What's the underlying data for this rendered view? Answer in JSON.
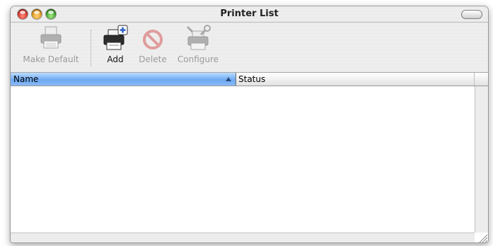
{
  "window": {
    "title": "Printer List"
  },
  "toolbar": {
    "make_default": {
      "label": "Make Default",
      "enabled": false
    },
    "add": {
      "label": "Add",
      "enabled": true
    },
    "delete": {
      "label": "Delete",
      "enabled": false
    },
    "configure": {
      "label": "Configure",
      "enabled": false
    }
  },
  "table": {
    "columns": [
      {
        "label": "Name",
        "sorted": "ascending"
      },
      {
        "label": "Status"
      }
    ],
    "rows": []
  },
  "colors": {
    "header_selected": "#6eaaf3",
    "close": "#d9342b",
    "minimize": "#e59a1c",
    "zoom": "#3fa42d"
  }
}
